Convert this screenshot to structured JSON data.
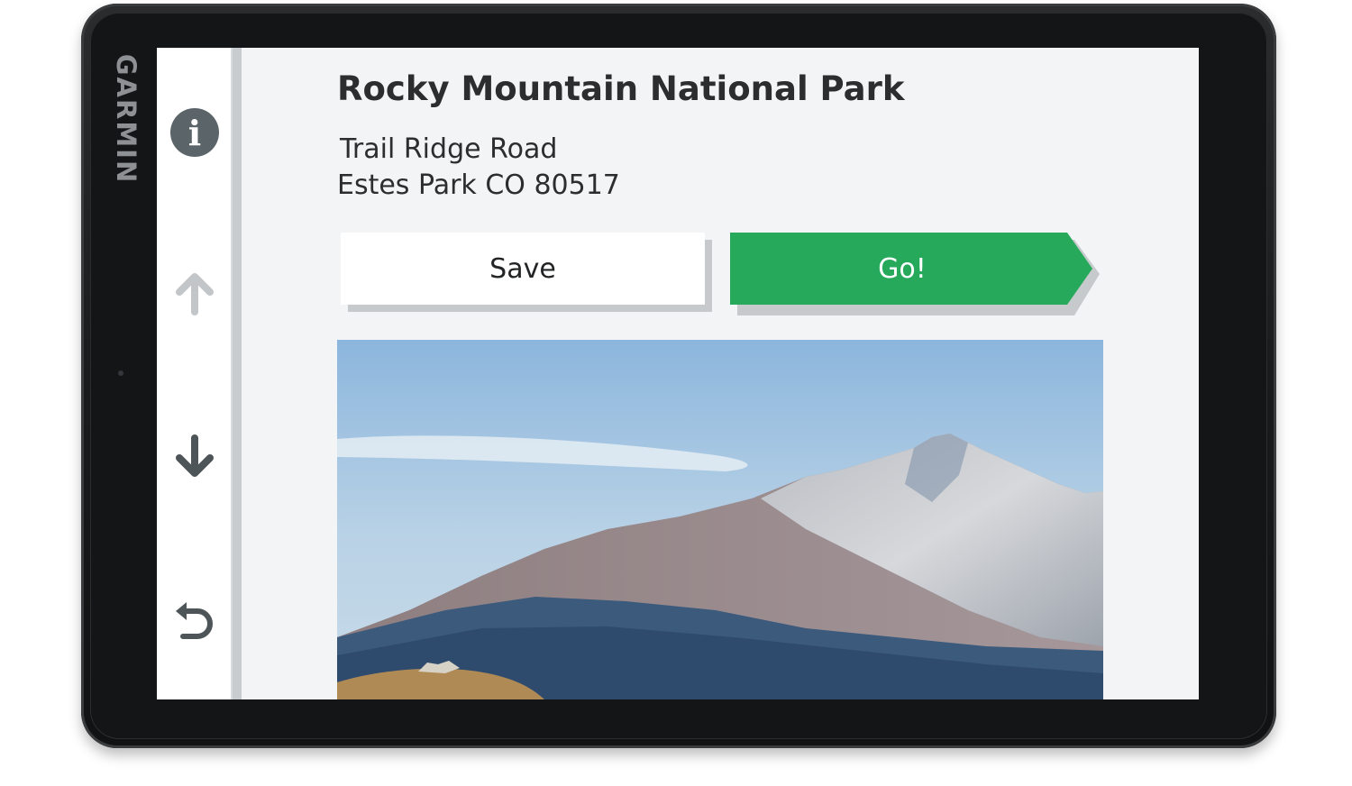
{
  "device": {
    "brand": "GARMIN"
  },
  "sidebar": {
    "info_icon": "info-icon",
    "up_icon": "arrow-up-icon",
    "down_icon": "arrow-down-icon",
    "back_icon": "back-icon"
  },
  "location": {
    "name": "Rocky Mountain National Park",
    "address_line1": "Trail Ridge Road",
    "address_line2": "Estes Park CO 80517"
  },
  "actions": {
    "save_label": "Save",
    "go_label": "Go!"
  },
  "colors": {
    "go_green": "#27a95c",
    "screen_bg": "#f2f4f5",
    "bezel": "#1a1b1c"
  }
}
